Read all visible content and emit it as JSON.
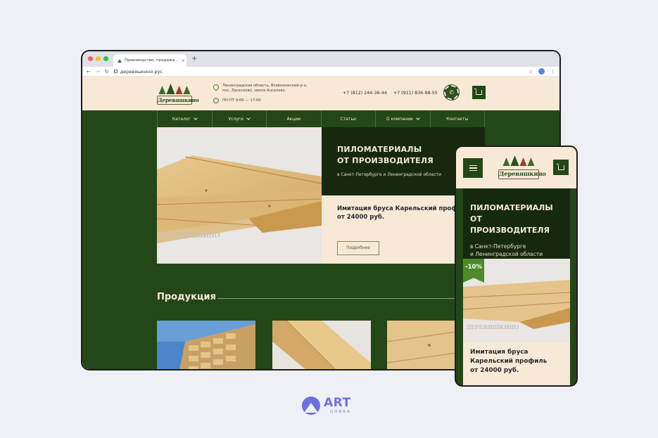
{
  "browser": {
    "tab_title": "Производство, продажа...",
    "tab_close": "×",
    "new_tab": "+",
    "url": "деревяшкино.рус",
    "back": "←",
    "forward": "→",
    "reload": "↻",
    "star": "☆",
    "menu": "⋮"
  },
  "header": {
    "logo_text": "Деревяшкино",
    "address": "Ленинградская область, Всеволожский р-н, пос. Ласколово, земля Ансалово.",
    "hours": "ПН-ПТ 9:00 — 17:00",
    "phone1": "+7 (812) 244-36-44",
    "phone2": "+7 (911) 836-98-55",
    "call_icon": "✆"
  },
  "nav": {
    "items": [
      {
        "label": "Каталог",
        "has_dropdown": true
      },
      {
        "label": "Услуги",
        "has_dropdown": true
      },
      {
        "label": "Акции",
        "has_dropdown": false
      },
      {
        "label": "Статьи",
        "has_dropdown": false
      },
      {
        "label": "О компании",
        "has_dropdown": true
      },
      {
        "label": "Контакты",
        "has_dropdown": false
      }
    ]
  },
  "hero": {
    "title_line1": "ПИЛОМАТЕРИАЛЫ",
    "title_line2": "ОТ ПРОИЗВОДИТЕЛЯ",
    "subtitle": "в Санкт-Петербурге и Ленинградской области",
    "offer": "Имитация бруса Карельский профиль от 24000 руб.",
    "button_label": "Подробнее",
    "watermark": "ДЕРЕВЯШКИНО"
  },
  "products": {
    "title": "Продукция"
  },
  "mobile": {
    "logo_text": "Деревяшкино",
    "title_line1": "ПИЛОМАТЕРИАЛЫ",
    "title_line2": "ОТ ПРОИЗВОДИТЕЛЯ",
    "subtitle_line1": "в Санкт-Петербурге",
    "subtitle_line2": "и Ленинградской области",
    "badge": "-10%",
    "offer_line1": "Имитация бруса",
    "offer_line2": "Карельский профиль",
    "offer_line3": "от 24000 руб.",
    "watermark": "ДЕРЕВЯШКИНО"
  },
  "brand": {
    "name": "ART",
    "sub": "GORKA"
  },
  "colors": {
    "forest_green": "#244718",
    "dark_green": "#16290e",
    "cream": "#f7e9d6",
    "accent_green": "#4c8a2a",
    "brand_violet": "#6a72e0"
  }
}
